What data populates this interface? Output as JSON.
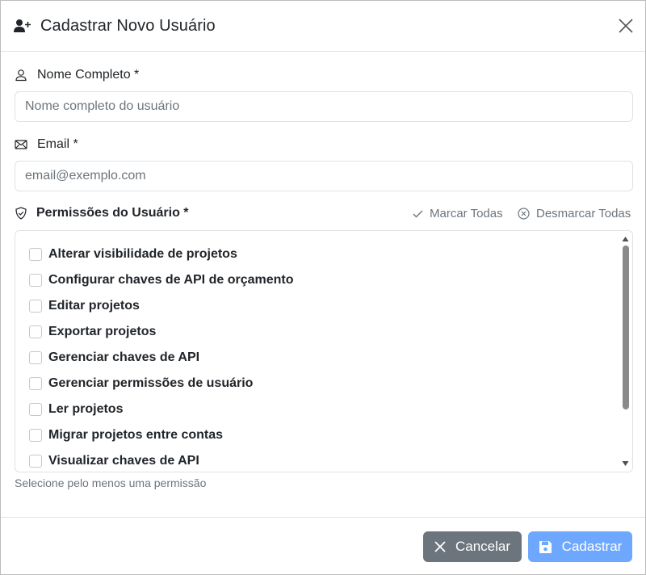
{
  "header": {
    "title": "Cadastrar Novo Usuário"
  },
  "form": {
    "name": {
      "label": "Nome Completo *",
      "placeholder": "Nome completo do usuário",
      "value": ""
    },
    "email": {
      "label": "Email *",
      "placeholder": "email@exemplo.com",
      "value": ""
    },
    "permissions": {
      "label": "Permissões do Usuário *",
      "select_all": "Marcar Todas",
      "deselect_all": "Desmarcar Todas",
      "items": [
        {
          "label": "Alterar visibilidade de projetos",
          "checked": false
        },
        {
          "label": "Configurar chaves de API de orçamento",
          "checked": false
        },
        {
          "label": "Editar projetos",
          "checked": false
        },
        {
          "label": "Exportar projetos",
          "checked": false
        },
        {
          "label": "Gerenciar chaves de API",
          "checked": false
        },
        {
          "label": "Gerenciar permissões de usuário",
          "checked": false
        },
        {
          "label": "Ler projetos",
          "checked": false
        },
        {
          "label": "Migrar projetos entre contas",
          "checked": false
        },
        {
          "label": "Visualizar chaves de API",
          "checked": false
        }
      ],
      "help": "Selecione pelo menos uma permissão"
    }
  },
  "footer": {
    "cancel_label": "Cancelar",
    "submit_label": "Cadastrar"
  },
  "colors": {
    "cancel_button": "#6c757d",
    "submit_button": "#6ea8fe",
    "border": "#dee2e6",
    "muted_text": "#6c757d"
  },
  "icons": {
    "title": "user-plus-icon",
    "close": "close-icon",
    "name": "person-icon",
    "email": "envelope-icon",
    "permissions": "shield-icon",
    "select_all": "check-icon",
    "deselect_all": "x-circle-icon",
    "cancel": "x-icon",
    "submit": "floppy-disk-icon"
  }
}
